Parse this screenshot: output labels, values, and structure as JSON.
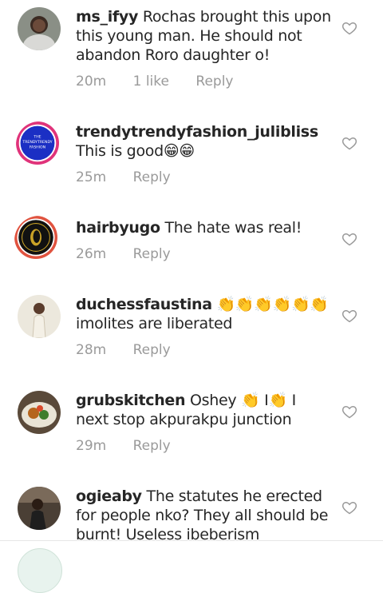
{
  "comments": [
    {
      "username": "ms_ifyy",
      "text": "Rochas brought this upon this young man. He should not abandon Roro daughter o!",
      "time": "20m",
      "likes": "1 like",
      "reply": "Reply"
    },
    {
      "username": "trendytrendyfashion_julibliss",
      "text": "This is good😁😁",
      "time": "25m",
      "reply": "Reply",
      "avatar_text_1": "THE",
      "avatar_text_2": "TRENDYTRENDY",
      "avatar_text_3": "FASHION"
    },
    {
      "username": "hairbyugo",
      "text": "The hate was real!",
      "time": "26m",
      "reply": "Reply"
    },
    {
      "username": "duchessfaustina",
      "text": "👏👏👏👏👏👏 imolites are liberated",
      "time": "28m",
      "reply": "Reply"
    },
    {
      "username": "grubskitchen",
      "text": "Oshey 👏 I👏 I next stop akpurakpu junction",
      "time": "29m",
      "reply": "Reply"
    },
    {
      "username": "ogieaby",
      "text": "The statutes he erected for people nko? They all should be burnt! Useless ibeberism",
      "time": "",
      "reply": ""
    }
  ],
  "icons": {
    "like": "heart-outline-icon"
  },
  "colors": {
    "meta": "#9a9a9a",
    "text": "#262626"
  }
}
